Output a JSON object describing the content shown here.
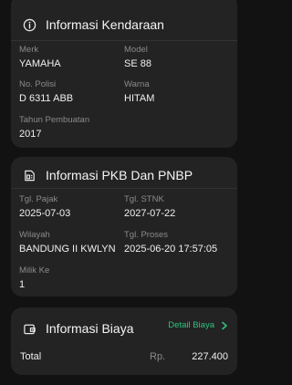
{
  "vehicle_info": {
    "title": "Informasi Kendaraan",
    "merk": {
      "label": "Merk",
      "value": "YAMAHA"
    },
    "model": {
      "label": "Model",
      "value": "SE 88"
    },
    "no_polisi": {
      "label": "No. Polisi",
      "value": "D 6311 ABB"
    },
    "warna": {
      "label": "Warna",
      "value": "HITAM"
    },
    "tahun_pembuatan": {
      "label": "Tahun Pembuatan",
      "value": "2017"
    }
  },
  "pkb_info": {
    "title": "Informasi PKB Dan PNBP",
    "tgl_pajak": {
      "label": "Tgl. Pajak",
      "value": "2025-07-03"
    },
    "tgl_stnk": {
      "label": "Tgl. STNK",
      "value": "2027-07-22"
    },
    "wilayah": {
      "label": "Wilayah",
      "value": "BANDUNG II KWLYN"
    },
    "tgl_proses": {
      "label": "Tgl. Proses",
      "value": "2025-06-20 17:57:05"
    },
    "milik_ke": {
      "label": "Milik Ke",
      "value": "1"
    }
  },
  "biaya_info": {
    "title": "Informasi Biaya",
    "detail_link": "Detail Biaya",
    "total_label": "Total",
    "currency": "Rp.",
    "total_value": "227.400"
  },
  "colors": {
    "background": "#121212",
    "card": "#232323",
    "accent_green": "#2ec27e",
    "label_gray": "#8a8a8a"
  },
  "icons": {
    "vehicle_header": "info-circle-icon",
    "pkb_header": "document-icon",
    "biaya_header": "wallet-icon",
    "detail_link": "chevron-right-icon"
  }
}
